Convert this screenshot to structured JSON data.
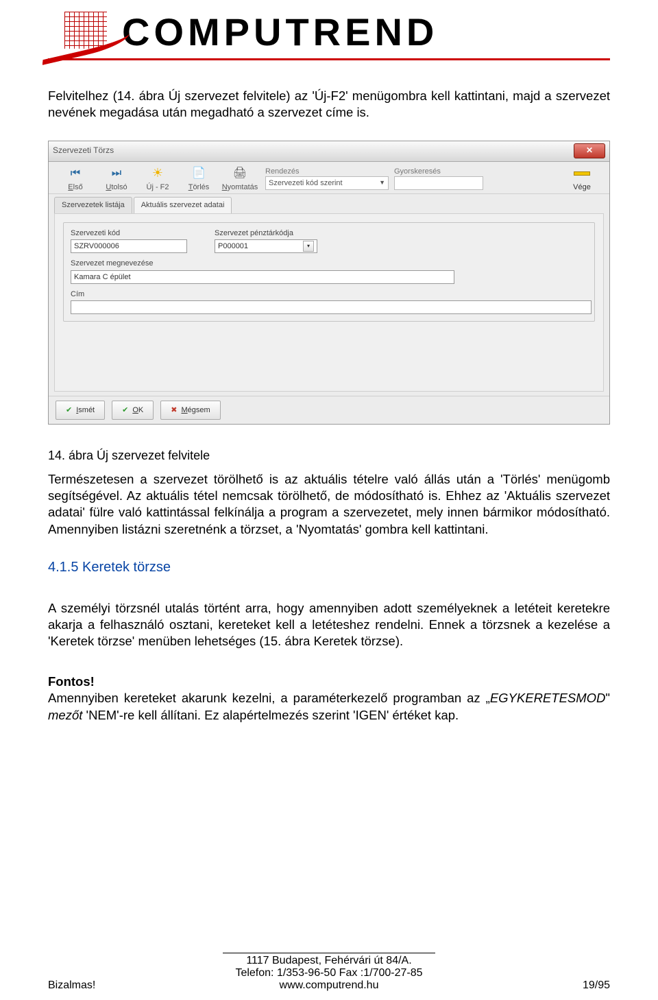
{
  "header": {
    "brand": "COMPUTREND"
  },
  "text": {
    "intro": "Felvitelhez (14. ábra Új szervezet felvitele) az 'Új-F2' menügombra kell kattintani, majd a szervezet nevének megadása után megadható a szervezet címe is.",
    "caption": "14. ábra Új szervezet felvitele",
    "para2": "Természetesen a szervezet törölhető is az aktuális tételre való állás után a 'Törlés' menügomb segítségével. Az aktuális tétel nemcsak törölhető, de módosítható is. Ehhez az 'Aktuális szervezet adatai' fülre való kattintással felkínálja a program a szervezetet, mely innen bármikor módosítható. Amennyiben listázni szeretnénk a törzset, a 'Nyomtatás' gombra kell kattintani.",
    "section_heading": "4.1.5  Keretek törzse",
    "para3": "A személyi törzsnél utalás történt arra, hogy amennyiben adott személyeknek a letéteit keretekre akarja a felhasználó osztani, kereteket kell a letéteshez rendelni. Ennek a törzsnek a kezelése a 'Keretek törzse' menüben lehetséges (15. ábra Keretek törzse).",
    "fontos_label": "Fontos!",
    "fontos_body_a": "Amennyiben kereteket akarunk kezelni, a paraméterkezelő programban az „",
    "fontos_body_italic": "EGYKERETESMOD",
    "fontos_body_b": "\" ",
    "fontos_body_c": "mezőt",
    "fontos_body_d": " 'NEM'-re kell állítani. Ez alapértelmezés szerint 'IGEN' értéket kap."
  },
  "window": {
    "title": "Szervezeti Törzs",
    "toolbar": {
      "first": "Első",
      "last": "Utolsó",
      "new": "Új - F2",
      "delete": "Törlés",
      "print": "Nyomtatás",
      "rendezes_label": "Rendezés",
      "rendezes_value": "Szervezeti kód szerint",
      "gyors_label": "Gyorskeresés",
      "gyors_value": "",
      "vege": "Vége"
    },
    "tabs": {
      "list": "Szervezetek listája",
      "current": "Aktuális szervezet adatai"
    },
    "fields": {
      "kod_label": "Szervezeti kód",
      "kod_value": "SZRV000006",
      "penztar_label": "Szervezet pénztárkódja",
      "penztar_value": "P000001",
      "megnev_label": "Szervezet megnevezése",
      "megnev_value": "Kamara C épület",
      "cim_label": "Cím",
      "cim_value": ""
    },
    "actions": {
      "ismet": "Ismét",
      "ok": "OK",
      "megsem": "Mégsem"
    }
  },
  "footer": {
    "addr": "1117 Budapest, Fehérvári út 84/A.",
    "tel": "Telefon: 1/353-96-50   Fax :1/700-27-85",
    "web": "www.computrend.hu",
    "left": "Bizalmas!",
    "right": "19/95"
  }
}
